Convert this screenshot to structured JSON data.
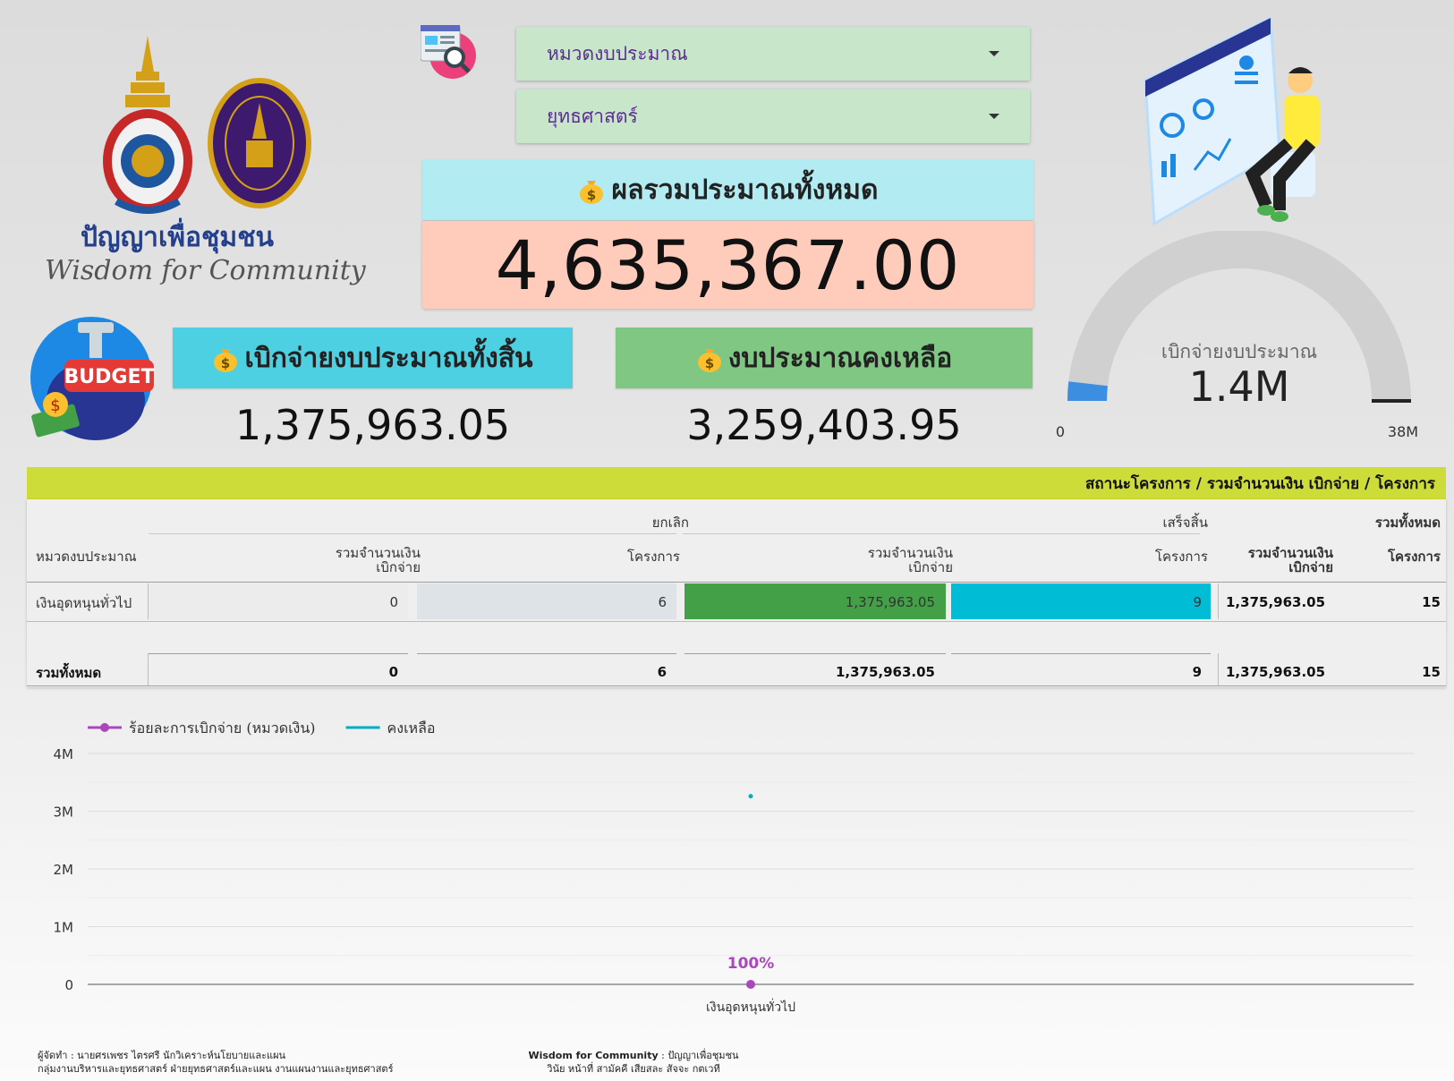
{
  "logo": {
    "tagline_th": "ปัญญาเพื่อชุมชน",
    "tagline_en": "Wisdom for Community",
    "colors": {
      "navy": "#243f8c",
      "purple": "#3d1a6e",
      "gold": "#d4a017"
    }
  },
  "filters": {
    "budget_category_label": "หมวดงบประมาณ",
    "strategy_label": "ยุทธศาสตร์"
  },
  "total": {
    "title": "ผลรวมประมาณทั้งหมด",
    "value": "4,635,367.00"
  },
  "spent": {
    "title": "เบิกจ่ายงบประมาณทั้งสิ้น",
    "value": "1,375,963.05"
  },
  "remaining": {
    "title": "งบประมาณคงเหลือ",
    "value": "3,259,403.95"
  },
  "budget_icon_text": "BUDGET",
  "gauge": {
    "label": "เบิกจ่ายงบประมาณ",
    "value_text": "1.4M",
    "value": 1375963.05,
    "min_label": "0",
    "max_label": "38M",
    "min": 0,
    "max": 38000000,
    "target_fraction": 1.0,
    "color": "#3b8ee0"
  },
  "table": {
    "header_bar": "สถานะโครงการ / รวมจำนวนเงิน เบิกจ่าย / โครงการ",
    "group_cancel": "ยกเลิก",
    "group_done": "เสร็จสิ้น",
    "group_total": "รวมทั้งหมด",
    "col_category": "หมวดงบประมาณ",
    "col_amount": "รวมจำนวนเงิน\nเบิกจ่าย",
    "col_projects": "โครงการ",
    "row": {
      "category": "เงินอุดหนุนทั่วไป",
      "cancel_amount": "0",
      "cancel_projects": "6",
      "done_amount": "1,375,963.05",
      "done_projects": "9",
      "total_amount": "1,375,963.05",
      "total_projects": "15"
    },
    "total_row": {
      "label": "รวมทั้งหมด",
      "cancel_amount": "0",
      "cancel_projects": "6",
      "done_amount": "1,375,963.05",
      "done_projects": "9",
      "total_amount": "1,375,963.05",
      "total_projects": "15"
    }
  },
  "chart_data": {
    "type": "line",
    "categories": [
      "เงินอุดหนุนทั่วไป"
    ],
    "series": [
      {
        "name": "ร้อยละการเบิกจ่าย (หมวดเงิน)",
        "values": [
          0
        ],
        "data_labels": [
          "100%"
        ],
        "color": "#ab47bc"
      },
      {
        "name": "คงเหลือ",
        "values": [
          3259403.95
        ],
        "color": "#00acc1"
      }
    ],
    "yticks": [
      0,
      1000000,
      2000000,
      3000000,
      4000000
    ],
    "ytick_labels": [
      "0",
      "1M",
      "2M",
      "3M",
      "4M"
    ],
    "ylim": [
      0,
      4000000
    ],
    "legend_position": "top-left",
    "grid": true
  },
  "footer": {
    "left_line1": "ผู้จัดทำ : นายศรเพชร ไตรศรี นักวิเคราะห์นโยบายและแผน",
    "left_line2": "กลุ่มงานบริหารและยุทธศาสตร์ ฝ่ายยุทธศาสตร์และแผน งานแผนงานและยุทธศาสตร์",
    "center_bold": "Wisdom for Community",
    "center_rest": " : ปัญญาเพื่อชุมชน",
    "center_line2": "วินัย หน้าที่ สามัคคี เสียสละ สัจจะ กตเวที"
  }
}
